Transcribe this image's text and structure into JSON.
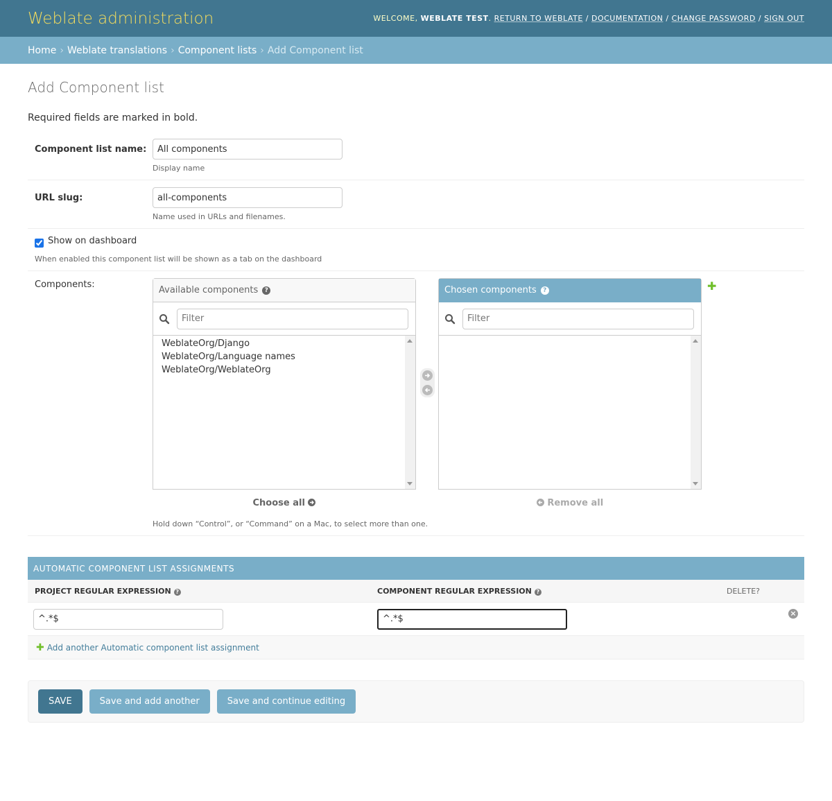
{
  "header": {
    "branding": "Weblate administration",
    "welcome": "Welcome,",
    "user": "Weblate Test",
    "links": [
      "Return to Weblate",
      "Documentation",
      "Change password",
      "Sign out"
    ]
  },
  "breadcrumbs": {
    "home": "Home",
    "app": "Weblate translations",
    "model": "Component lists",
    "current": "Add Component list"
  },
  "page": {
    "title": "Add Component list",
    "note": "Required fields are marked in bold."
  },
  "form": {
    "name": {
      "label": "Component list name:",
      "value": "All components",
      "help": "Display name"
    },
    "slug": {
      "label": "URL slug:",
      "value": "all-components",
      "help": "Name used in URLs and filenames."
    },
    "dashboard": {
      "label": "Show on dashboard",
      "checked": true,
      "help": "When enabled this component list will be shown as a tab on the dashboard"
    },
    "components": {
      "label": "Components:",
      "available_title": "Available components",
      "chosen_title": "Chosen components",
      "filter_placeholder": "Filter",
      "available": [
        "WeblateOrg/Django",
        "WeblateOrg/Language names",
        "WeblateOrg/WeblateOrg"
      ],
      "chosen": [],
      "choose_all": "Choose all",
      "remove_all": "Remove all",
      "help": "Hold down “Control”, or “Command” on a Mac, to select more than one."
    }
  },
  "inline": {
    "title": "AUTOMATIC COMPONENT LIST ASSIGNMENTS",
    "col_project": "Project regular expression",
    "col_component": "Component regular expression",
    "col_delete": "Delete?",
    "project_value": "^.*$",
    "component_value": "^.*$",
    "add_another": "Add another Automatic component list assignment"
  },
  "submit": {
    "save": "SAVE",
    "save_add": "Save and add another",
    "save_continue": "Save and continue editing"
  },
  "colors": {
    "header": "#417690",
    "breadcrumbs": "#79aec8",
    "branding": "#f5dd5d",
    "add": "#70bf2b"
  }
}
